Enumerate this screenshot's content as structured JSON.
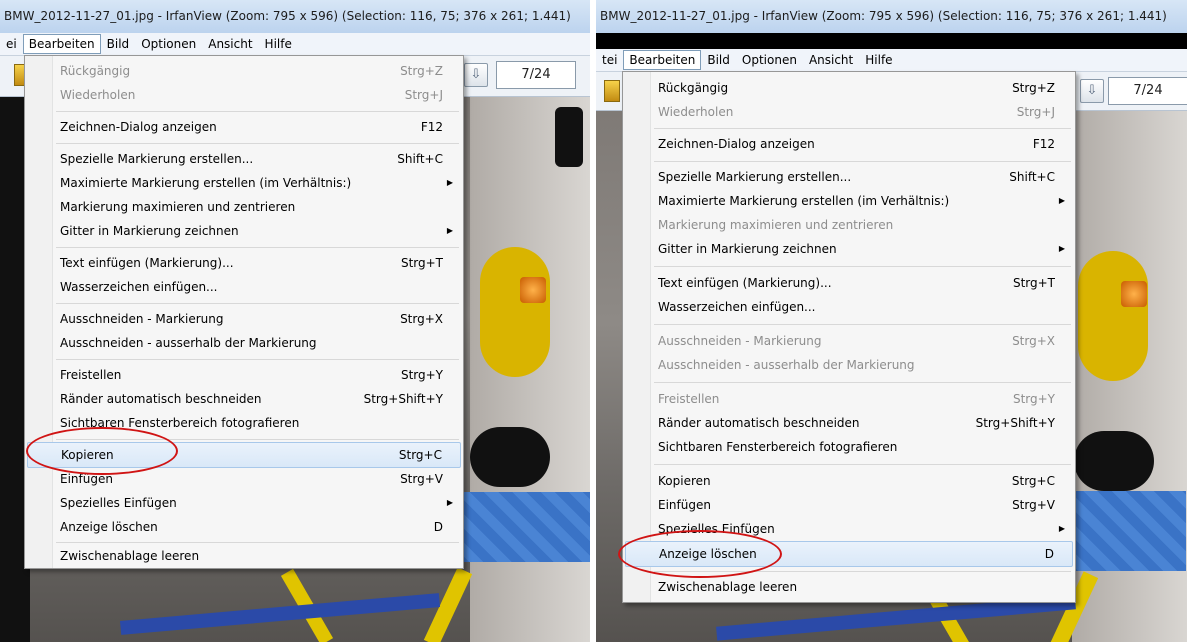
{
  "left": {
    "title": "BMW_2012-11-27_01.jpg - IrfanView (Zoom: 795 x 596) (Selection: 116, 75; 376 x 261; 1.441)",
    "menubar": [
      "ei",
      "Bearbeiten",
      "Bild",
      "Optionen",
      "Ansicht",
      "Hilfe"
    ],
    "page_counter": "7/24",
    "items": [
      {
        "label": "Rückgängig",
        "shortcut": "Strg+Z",
        "disabled": true
      },
      {
        "label": "Wiederholen",
        "shortcut": "Strg+J",
        "disabled": true
      },
      {
        "label": "Zeichnen-Dialog anzeigen",
        "shortcut": "F12"
      },
      {
        "label": "Spezielle Markierung erstellen...",
        "shortcut": "Shift+C"
      },
      {
        "label": "Maximierte Markierung erstellen (im Verhältnis:)",
        "submenu": true
      },
      {
        "label": "Markierung maximieren und zentrieren"
      },
      {
        "label": "Gitter in Markierung zeichnen",
        "submenu": true
      },
      {
        "label": "Text einfügen (Markierung)...",
        "shortcut": "Strg+T"
      },
      {
        "label": "Wasserzeichen einfügen..."
      },
      {
        "label": "Ausschneiden - Markierung",
        "shortcut": "Strg+X"
      },
      {
        "label": "Ausschneiden - ausserhalb der Markierung"
      },
      {
        "label": "Freistellen",
        "shortcut": "Strg+Y"
      },
      {
        "label": "Ränder automatisch beschneiden",
        "shortcut": "Strg+Shift+Y"
      },
      {
        "label": "Sichtbaren Fensterbereich fotografieren"
      },
      {
        "label": "Kopieren",
        "shortcut": "Strg+C",
        "highlighted": true
      },
      {
        "label": "Einfügen",
        "shortcut": "Strg+V"
      },
      {
        "label": "Spezielles Einfügen",
        "submenu": true
      },
      {
        "label": "Anzeige löschen",
        "shortcut": "D"
      },
      {
        "label": "Zwischenablage leeren"
      }
    ]
  },
  "right": {
    "title": "BMW_2012-11-27_01.jpg - IrfanView (Zoom: 795 x 596) (Selection: 116, 75; 376 x 261; 1.441)",
    "menubar": [
      "tei",
      "Bearbeiten",
      "Bild",
      "Optionen",
      "Ansicht",
      "Hilfe"
    ],
    "page_counter": "7/24",
    "items": [
      {
        "label": "Rückgängig",
        "shortcut": "Strg+Z"
      },
      {
        "label": "Wiederholen",
        "shortcut": "Strg+J",
        "disabled": true
      },
      {
        "label": "Zeichnen-Dialog anzeigen",
        "shortcut": "F12"
      },
      {
        "label": "Spezielle Markierung erstellen...",
        "shortcut": "Shift+C"
      },
      {
        "label": "Maximierte Markierung erstellen (im Verhältnis:)",
        "submenu": true
      },
      {
        "label": "Markierung maximieren und zentrieren",
        "disabled": true
      },
      {
        "label": "Gitter in Markierung zeichnen",
        "submenu": true
      },
      {
        "label": "Text einfügen (Markierung)...",
        "shortcut": "Strg+T"
      },
      {
        "label": "Wasserzeichen einfügen..."
      },
      {
        "label": "Ausschneiden - Markierung",
        "shortcut": "Strg+X",
        "disabled": true
      },
      {
        "label": "Ausschneiden - ausserhalb der Markierung",
        "disabled": true
      },
      {
        "label": "Freistellen",
        "shortcut": "Strg+Y",
        "disabled": true
      },
      {
        "label": "Ränder automatisch beschneiden",
        "shortcut": "Strg+Shift+Y"
      },
      {
        "label": "Sichtbaren Fensterbereich fotografieren"
      },
      {
        "label": "Kopieren",
        "shortcut": "Strg+C"
      },
      {
        "label": "Einfügen",
        "shortcut": "Strg+V"
      },
      {
        "label": "Spezielles Einfügen",
        "submenu": true
      },
      {
        "label": "Anzeige löschen",
        "shortcut": "D",
        "highlighted": true
      },
      {
        "label": "Zwischenablage leeren"
      }
    ]
  }
}
